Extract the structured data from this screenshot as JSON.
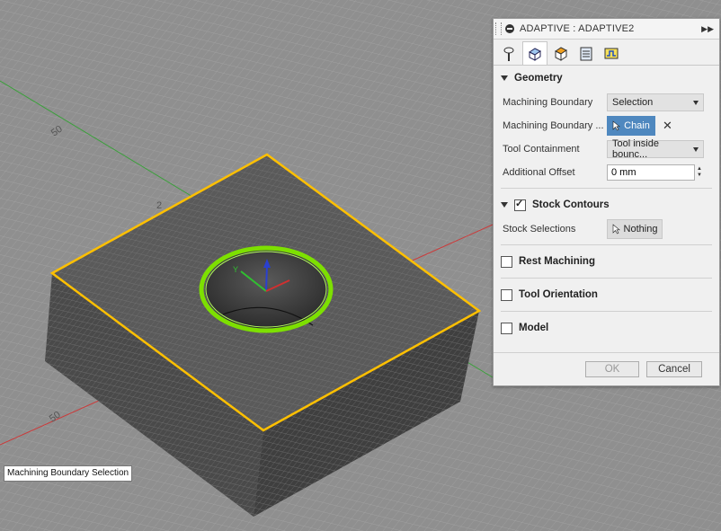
{
  "viewport": {
    "axis_labels": [
      "50",
      "2",
      "50"
    ],
    "tooltip": "Machining Boundary Selection"
  },
  "panel": {
    "title": "ADAPTIVE : ADAPTIVE2",
    "tabs": [
      "tool-icon",
      "geometry-icon",
      "heights-icon",
      "passes-icon",
      "linking-icon"
    ],
    "sections": {
      "geometry": {
        "label": "Geometry",
        "machining_boundary_label": "Machining Boundary",
        "machining_boundary_value": "Selection",
        "boundary_selection_label": "Machining Boundary ...",
        "chain_label": "Chain",
        "tool_containment_label": "Tool Containment",
        "tool_containment_value": "Tool inside bounc...",
        "additional_offset_label": "Additional Offset",
        "additional_offset_value": "0 mm"
      },
      "stock_contours": {
        "label": "Stock Contours",
        "checked": true,
        "stock_selections_label": "Stock Selections",
        "nothing_label": "Nothing"
      },
      "rest_machining": {
        "label": "Rest Machining",
        "checked": false
      },
      "tool_orientation": {
        "label": "Tool Orientation",
        "checked": false
      },
      "model": {
        "label": "Model",
        "checked": false
      }
    },
    "ok_label": "OK",
    "cancel_label": "Cancel"
  },
  "colors": {
    "boundary": "#ffc000",
    "hole_selection": "#7de000",
    "chain_button": "#4f88bf",
    "axis_x": "#d03030",
    "axis_y": "#30a030"
  }
}
